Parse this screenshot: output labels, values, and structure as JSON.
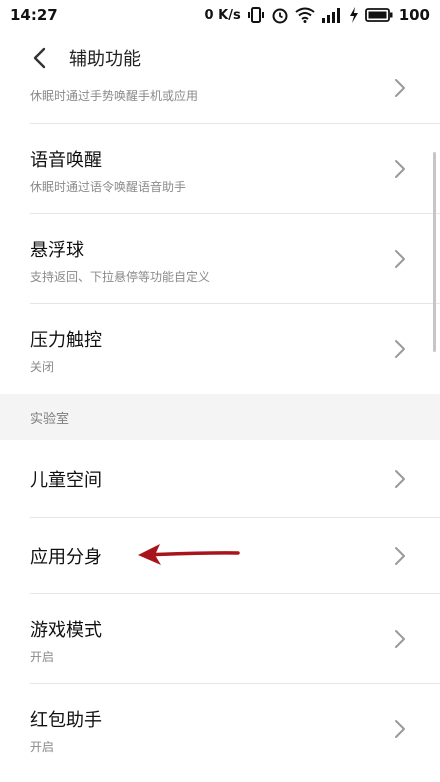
{
  "status_bar": {
    "time": "14:27",
    "net_speed": "0 K/s",
    "battery": "100"
  },
  "header": {
    "title": "辅助功能"
  },
  "items": [
    {
      "title": "",
      "subtitle": "休眠时通过手势唤醒手机或应用"
    },
    {
      "title": "语音唤醒",
      "subtitle": "休眠时通过语令唤醒语音助手"
    },
    {
      "title": "悬浮球",
      "subtitle": "支持返回、下拉悬停等功能自定义"
    },
    {
      "title": "压力触控",
      "subtitle": "关闭"
    }
  ],
  "section": {
    "label": "实验室"
  },
  "lab_items": [
    {
      "title": "儿童空间"
    },
    {
      "title": "应用分身"
    },
    {
      "title": "游戏模式",
      "subtitle": "开启"
    },
    {
      "title": "红包助手",
      "subtitle": "开启"
    }
  ],
  "colors": {
    "annotation_arrow": "#a8141c",
    "chevron": "#9a9a9a",
    "section_bg": "#f4f4f4"
  }
}
